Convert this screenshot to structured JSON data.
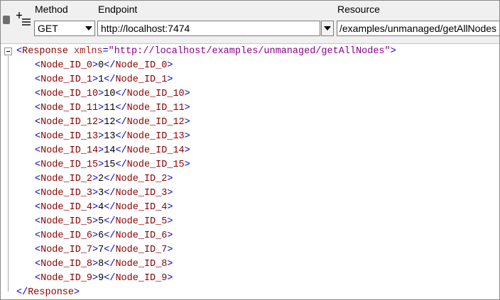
{
  "toolbar": {
    "method_label": "Method",
    "endpoint_label": "Endpoint",
    "resource_label": "Resource",
    "method_value": "GET",
    "endpoint_value": "http://localhost:7474",
    "resource_value": "/examples/unmanaged/getAllNodes"
  },
  "response": {
    "root_tag": "Response",
    "attr_name": "xmlns",
    "attr_value": "\"http://localhost/examples/unmanaged/getAllNodes\"",
    "nodes": [
      {
        "tag": "Node_ID_0",
        "value": "0"
      },
      {
        "tag": "Node_ID_1",
        "value": "1"
      },
      {
        "tag": "Node_ID_10",
        "value": "10"
      },
      {
        "tag": "Node_ID_11",
        "value": "11"
      },
      {
        "tag": "Node_ID_12",
        "value": "12"
      },
      {
        "tag": "Node_ID_13",
        "value": "13"
      },
      {
        "tag": "Node_ID_14",
        "value": "14"
      },
      {
        "tag": "Node_ID_15",
        "value": "15"
      },
      {
        "tag": "Node_ID_2",
        "value": "2"
      },
      {
        "tag": "Node_ID_3",
        "value": "3"
      },
      {
        "tag": "Node_ID_4",
        "value": "4"
      },
      {
        "tag": "Node_ID_5",
        "value": "5"
      },
      {
        "tag": "Node_ID_6",
        "value": "6"
      },
      {
        "tag": "Node_ID_7",
        "value": "7"
      },
      {
        "tag": "Node_ID_8",
        "value": "8"
      },
      {
        "tag": "Node_ID_9",
        "value": "9"
      }
    ]
  }
}
